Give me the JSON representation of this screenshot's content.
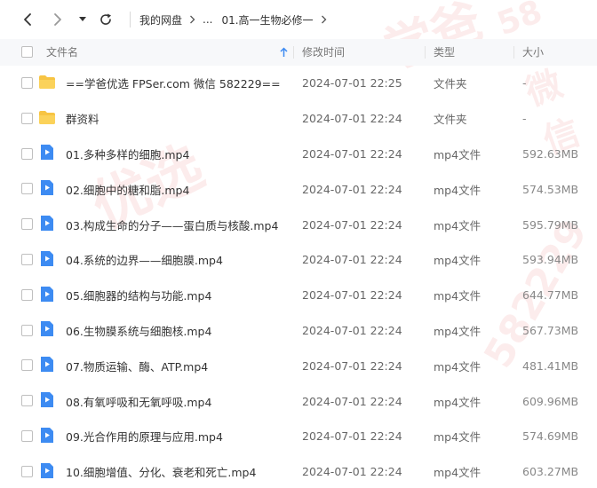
{
  "breadcrumb": {
    "root": "我的网盘",
    "ellipsis": "...",
    "current": "01.高一生物必修一"
  },
  "columns": {
    "name": "文件名",
    "modified": "修改时间",
    "type": "类型",
    "size": "大小"
  },
  "files": [
    {
      "name": "==学爸优选 FPSer.com 微信 582229==",
      "modified": "2024-07-01 22:25",
      "type": "文件夹",
      "size": "-",
      "kind": "folder"
    },
    {
      "name": "群资料",
      "modified": "2024-07-01 22:24",
      "type": "文件夹",
      "size": "-",
      "kind": "folder"
    },
    {
      "name": "01.多种多样的细胞.mp4",
      "modified": "2024-07-01 22:24",
      "type": "mp4文件",
      "size": "592.63MB",
      "kind": "video"
    },
    {
      "name": "02.细胞中的糖和脂.mp4",
      "modified": "2024-07-01 22:24",
      "type": "mp4文件",
      "size": "574.53MB",
      "kind": "video"
    },
    {
      "name": "03.构成生命的分子——蛋白质与核酸.mp4",
      "modified": "2024-07-01 22:24",
      "type": "mp4文件",
      "size": "595.79MB",
      "kind": "video"
    },
    {
      "name": "04.系统的边界——细胞膜.mp4",
      "modified": "2024-07-01 22:24",
      "type": "mp4文件",
      "size": "593.94MB",
      "kind": "video"
    },
    {
      "name": "05.细胞器的结构与功能.mp4",
      "modified": "2024-07-01 22:24",
      "type": "mp4文件",
      "size": "644.77MB",
      "kind": "video"
    },
    {
      "name": "06.生物膜系统与细胞核.mp4",
      "modified": "2024-07-01 22:24",
      "type": "mp4文件",
      "size": "567.73MB",
      "kind": "video"
    },
    {
      "name": "07.物质运输、酶、ATP.mp4",
      "modified": "2024-07-01 22:24",
      "type": "mp4文件",
      "size": "481.41MB",
      "kind": "video"
    },
    {
      "name": "08.有氧呼吸和无氧呼吸.mp4",
      "modified": "2024-07-01 22:24",
      "type": "mp4文件",
      "size": "609.96MB",
      "kind": "video"
    },
    {
      "name": "09.光合作用的原理与应用.mp4",
      "modified": "2024-07-01 22:24",
      "type": "mp4文件",
      "size": "574.69MB",
      "kind": "video"
    },
    {
      "name": "10.细胞增值、分化、衰老和死亡.mp4",
      "modified": "2024-07-01 22:24",
      "type": "mp4文件",
      "size": "603.27MB",
      "kind": "video"
    }
  ],
  "watermark": {
    "text1": "学爸",
    "text2": "微信",
    "text3": "优选",
    "text4": "58",
    "text5": "582229"
  },
  "colors": {
    "folder": "#f7c443",
    "video": "#3d8bf2",
    "sort_arrow": "#3d8bf2"
  },
  "icons": {
    "back": "chevron-left-icon",
    "forward": "chevron-right-icon",
    "history": "caret-down-icon",
    "refresh": "refresh-icon",
    "folder": "folder-icon",
    "video": "video-file-icon",
    "sort": "arrow-up-icon"
  }
}
